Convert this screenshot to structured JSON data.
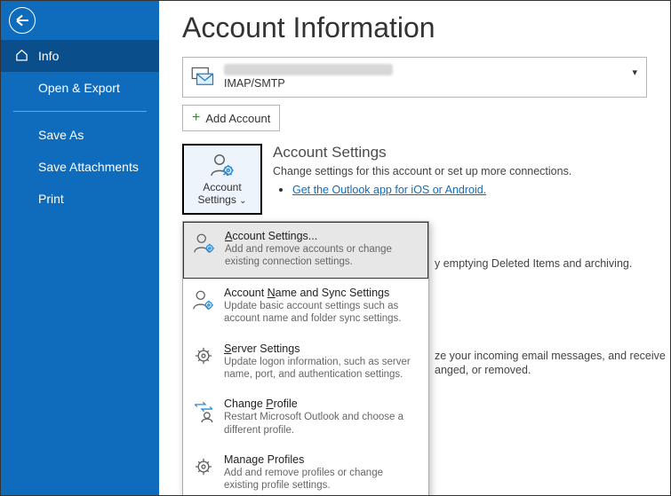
{
  "sidebar": {
    "items": [
      {
        "label": "Info",
        "active": true,
        "icon": "home-icon"
      },
      {
        "label": "Open & Export"
      },
      {
        "label": "Save As"
      },
      {
        "label": "Save Attachments"
      },
      {
        "label": "Print"
      }
    ]
  },
  "title": "Account Information",
  "account": {
    "email": "████████████████████",
    "type": "IMAP/SMTP"
  },
  "add_account_label": "Add Account",
  "section_account_settings": {
    "button_line1": "Account",
    "button_line2": "Settings",
    "heading": "Account Settings",
    "desc": "Change settings for this account or set up more connections.",
    "link": "Get the Outlook app for iOS or Android."
  },
  "menu": [
    {
      "title": "Account Settings...",
      "title_u": "A",
      "desc": "Add and remove accounts or change existing connection settings.",
      "selected": true,
      "icon": "person-gear"
    },
    {
      "title": "Account Name and Sync Settings",
      "title_u": "N",
      "desc": "Update basic account settings such as account name and folder sync settings.",
      "icon": "person-gear"
    },
    {
      "title": "Server Settings",
      "title_u": "S",
      "desc": "Update logon information, such as server name, port, and authentication settings.",
      "icon": "gear"
    },
    {
      "title": "Change Profile",
      "title_u": "P",
      "desc": "Restart Microsoft Outlook and choose a different profile.",
      "icon": "arrows-person"
    },
    {
      "title": "Manage Profiles",
      "title_u": "O",
      "desc": "Add and remove profiles or change existing profile settings.",
      "icon": "gear"
    }
  ],
  "bg_text": {
    "line1": "y emptying Deleted Items and archiving.",
    "line2": "ze your incoming email messages, and receive",
    "line3": "anged, or removed."
  }
}
